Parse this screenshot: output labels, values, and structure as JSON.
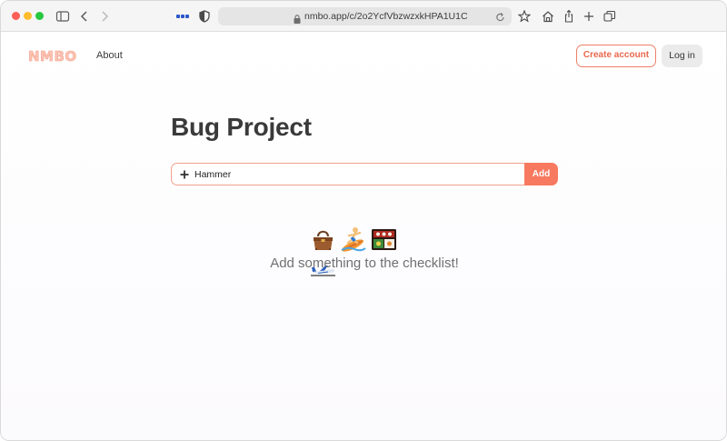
{
  "browser": {
    "url": "nmbo.app/c/2o2YcfVbzwzxkHPA1U1C",
    "colors": {
      "close": "#fe5f57",
      "minimize": "#febc2e",
      "maximize": "#28c840"
    }
  },
  "nav": {
    "logo": "NMBO",
    "about": "About",
    "create_account": "Create account",
    "log_in": "Log in"
  },
  "main": {
    "title": "Bug Project",
    "add_input_value": "Hammer",
    "add_button": "Add",
    "empty_icons": [
      "handbag-icon",
      "surfer-icon",
      "bento-box-icon",
      "airplane-icon"
    ],
    "empty_message": "Add something to the checklist!"
  },
  "colors": {
    "accent": "#f77a60",
    "accent_border": "#ef7f68",
    "logo": "#fbc4b5"
  }
}
